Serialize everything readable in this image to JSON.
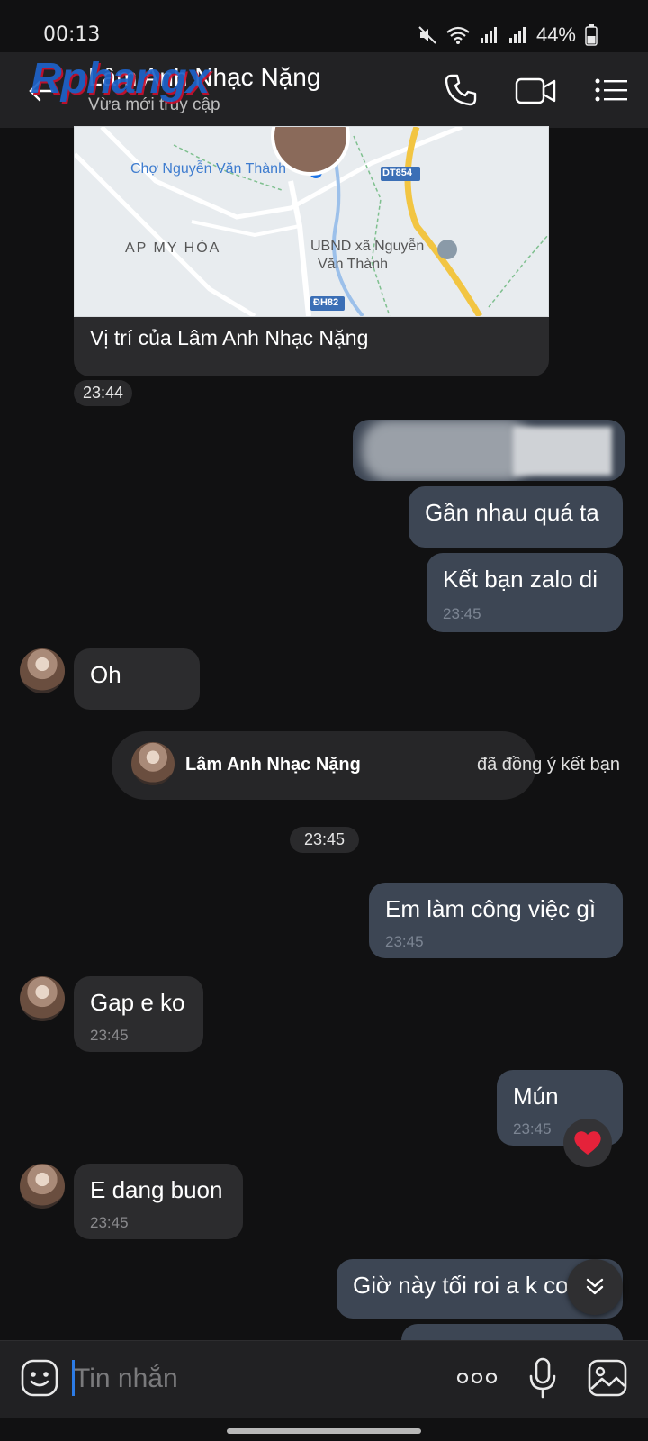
{
  "status": {
    "time": "00:13",
    "battery": "44%"
  },
  "header": {
    "watermark": "Rphangx",
    "contact_name": "Lâm Anh Nhạc Nặng",
    "subtitle": "Vừa mới truy cập"
  },
  "map": {
    "labels": [
      "Chợ Nguyễn Văn Thành",
      "DT854",
      "AP MY HÒA",
      "UBND xã Nguyễn",
      "Văn Thành",
      "ĐH82"
    ],
    "caption": "Vị trí của Lâm Anh Nhạc Nặng"
  },
  "messages": {
    "t1": "23:44",
    "out1": "Gần nhau quá ta",
    "out2": "Kết bạn zalo di",
    "out2_time": "23:45",
    "in1": "Oh",
    "system_name": "Lâm Anh Nhạc Nặng",
    "system_rest": "đã đồng ý kết bạn",
    "t2": "23:45",
    "out3": "Em làm công việc gì",
    "out3_time": "23:45",
    "in2": "Gap e ko",
    "in2_time": "23:45",
    "out4": "Mún",
    "out4_time": "23:45",
    "in3": "E dang buon",
    "in3_time": "23:45",
    "out5": "Giờ này tối roi a k co"
  },
  "composer": {
    "placeholder": "Tin nhắn"
  },
  "colors": {
    "accent": "#2c7be5",
    "bubble_out": "#3d4654",
    "bubble_in": "#2c2c2e",
    "heart": "#e5223a"
  }
}
